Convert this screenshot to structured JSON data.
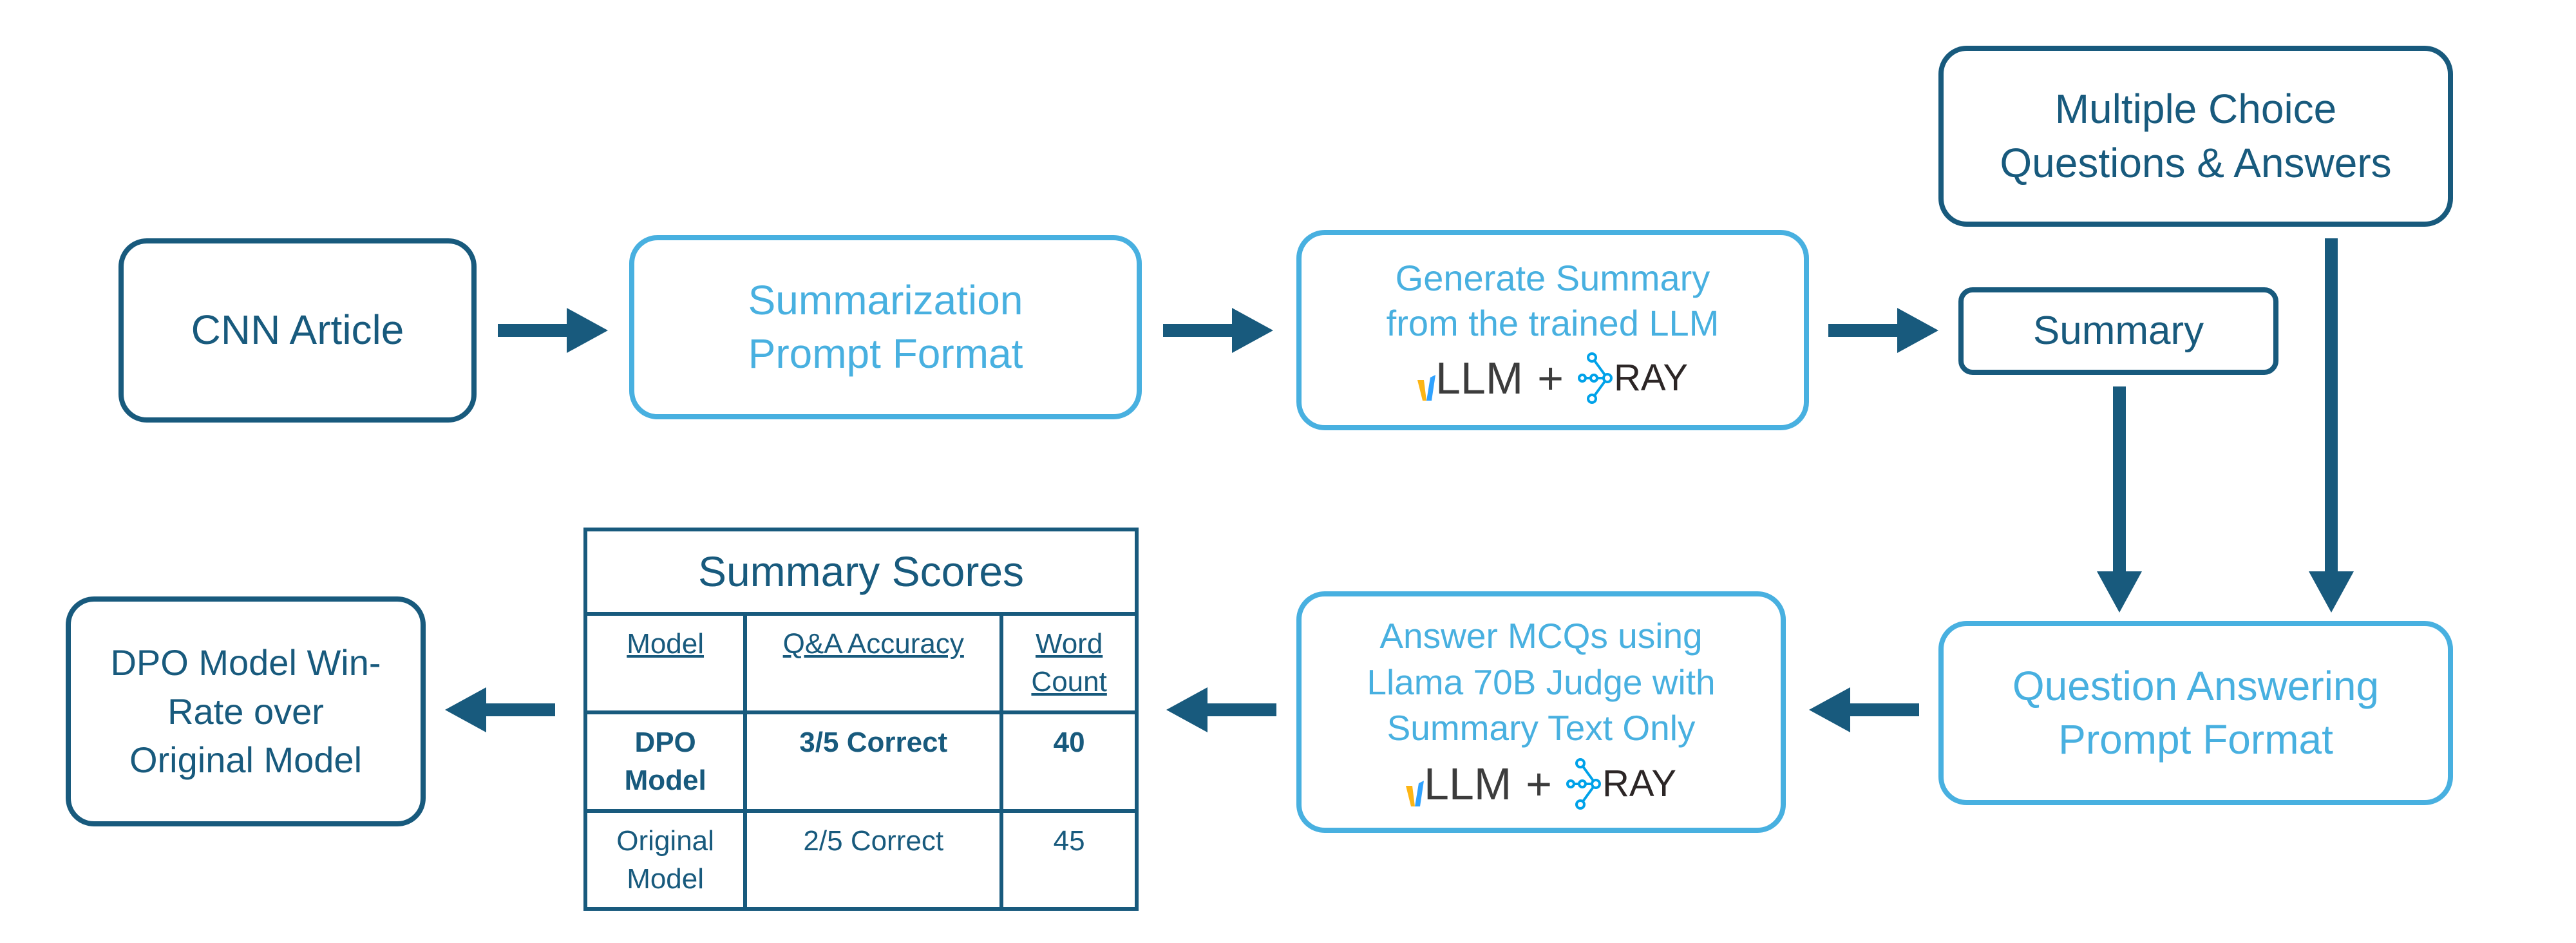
{
  "colors": {
    "dark": "#185a7d",
    "light": "#48b0e0",
    "vllm_yellow": "#fdb515",
    "vllm_blue": "#30a2ff",
    "ray_blue": "#00a2e9"
  },
  "nodes": {
    "cnn_article": "CNN Article",
    "summarization_prompt": {
      "line1": "Summarization",
      "line2": "Prompt Format"
    },
    "generate_summary": {
      "line1": "Generate Summary",
      "line2": "from the trained LLM"
    },
    "summary": "Summary",
    "mcq": {
      "line1": "Multiple Choice",
      "line2": "Questions & Answers"
    },
    "qa_prompt": {
      "line1": "Question Answering",
      "line2": "Prompt Format"
    },
    "answer_mcqs": {
      "line1": "Answer MCQs using",
      "line2": "Llama 70B Judge with",
      "line3": "Summary Text Only"
    },
    "win_rate": {
      "line1": "DPO Model Win-",
      "line2": "Rate over",
      "line3": "Original Model"
    }
  },
  "logos": {
    "vllm": "LLM",
    "plus": "+",
    "ray": "RAY"
  },
  "table": {
    "title": "Summary Scores",
    "headers": [
      "Model",
      "Q&A Accuracy",
      "Word Count"
    ],
    "rows": [
      {
        "model": "DPO Model",
        "accuracy": "3/5 Correct",
        "word_count": "40"
      },
      {
        "model": "Original Model",
        "accuracy": "2/5 Correct",
        "word_count": "45"
      }
    ]
  }
}
